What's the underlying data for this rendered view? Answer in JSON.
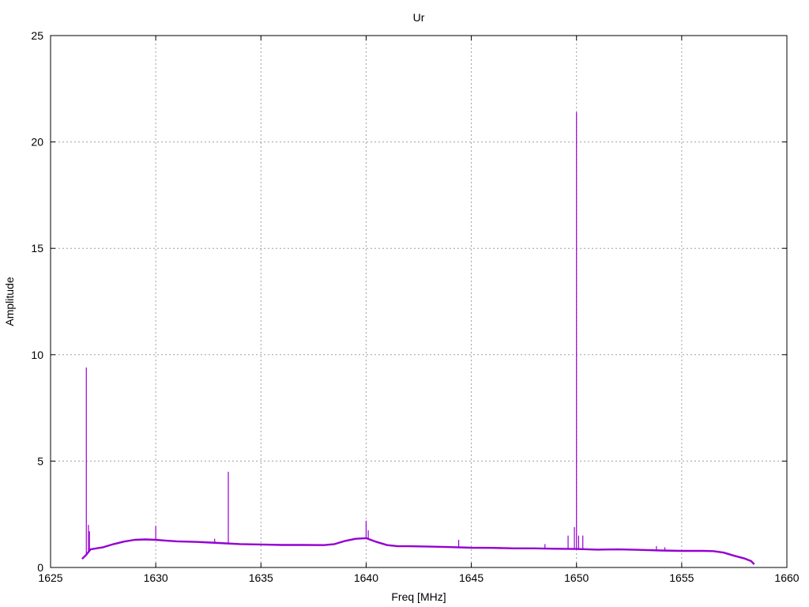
{
  "chart_data": {
    "type": "line",
    "title": "Ur",
    "xlabel": "Freq [MHz]",
    "ylabel": "Amplitude",
    "xlim": [
      1625,
      1660
    ],
    "ylim": [
      0,
      25
    ],
    "x_ticks": [
      1625,
      1630,
      1635,
      1640,
      1645,
      1650,
      1655,
      1660
    ],
    "y_ticks": [
      0,
      5,
      10,
      15,
      20,
      25
    ],
    "x_tick_labels": [
      "1625",
      "1630",
      "1635",
      "1640",
      "1645",
      "1650",
      "1655",
      "1660"
    ],
    "y_tick_labels": [
      "0",
      "5",
      "10",
      "15",
      "20",
      "25"
    ],
    "grid": true,
    "legend": "none",
    "series": [
      {
        "color": "#9400d3",
        "baseline": [
          [
            1626.5,
            0.4
          ],
          [
            1626.7,
            0.6
          ],
          [
            1626.9,
            0.85
          ],
          [
            1627.5,
            0.95
          ],
          [
            1628.0,
            1.1
          ],
          [
            1628.5,
            1.22
          ],
          [
            1629.0,
            1.3
          ],
          [
            1629.5,
            1.32
          ],
          [
            1630.0,
            1.3
          ],
          [
            1630.5,
            1.26
          ],
          [
            1631.0,
            1.23
          ],
          [
            1632.0,
            1.2
          ],
          [
            1633.0,
            1.15
          ],
          [
            1634.0,
            1.1
          ],
          [
            1635.0,
            1.08
          ],
          [
            1636.0,
            1.06
          ],
          [
            1637.0,
            1.06
          ],
          [
            1638.0,
            1.05
          ],
          [
            1638.5,
            1.1
          ],
          [
            1639.0,
            1.25
          ],
          [
            1639.5,
            1.35
          ],
          [
            1640.0,
            1.38
          ],
          [
            1640.5,
            1.2
          ],
          [
            1641.0,
            1.05
          ],
          [
            1641.5,
            1.0
          ],
          [
            1642.0,
            1.0
          ],
          [
            1643.0,
            0.98
          ],
          [
            1644.0,
            0.96
          ],
          [
            1645.0,
            0.93
          ],
          [
            1646.0,
            0.92
          ],
          [
            1647.0,
            0.9
          ],
          [
            1648.0,
            0.9
          ],
          [
            1649.0,
            0.88
          ],
          [
            1650.0,
            0.87
          ],
          [
            1651.0,
            0.84
          ],
          [
            1652.0,
            0.85
          ],
          [
            1653.0,
            0.83
          ],
          [
            1654.0,
            0.8
          ],
          [
            1655.0,
            0.78
          ],
          [
            1656.0,
            0.78
          ],
          [
            1656.5,
            0.77
          ],
          [
            1657.0,
            0.7
          ],
          [
            1657.5,
            0.55
          ],
          [
            1658.0,
            0.42
          ],
          [
            1658.3,
            0.3
          ],
          [
            1658.45,
            0.15
          ]
        ],
        "peaks": [
          [
            1626.7,
            9.4
          ],
          [
            1626.8,
            2.0
          ],
          [
            1626.85,
            1.7
          ],
          [
            1630.0,
            1.95
          ],
          [
            1632.8,
            1.35
          ],
          [
            1633.45,
            4.5
          ],
          [
            1640.0,
            2.2
          ],
          [
            1640.1,
            1.75
          ],
          [
            1644.4,
            1.3
          ],
          [
            1648.5,
            1.1
          ],
          [
            1649.6,
            1.5
          ],
          [
            1649.9,
            1.9
          ],
          [
            1650.0,
            21.4
          ],
          [
            1650.1,
            1.5
          ],
          [
            1650.3,
            1.5
          ],
          [
            1653.8,
            1.0
          ],
          [
            1654.2,
            0.95
          ]
        ]
      }
    ]
  }
}
